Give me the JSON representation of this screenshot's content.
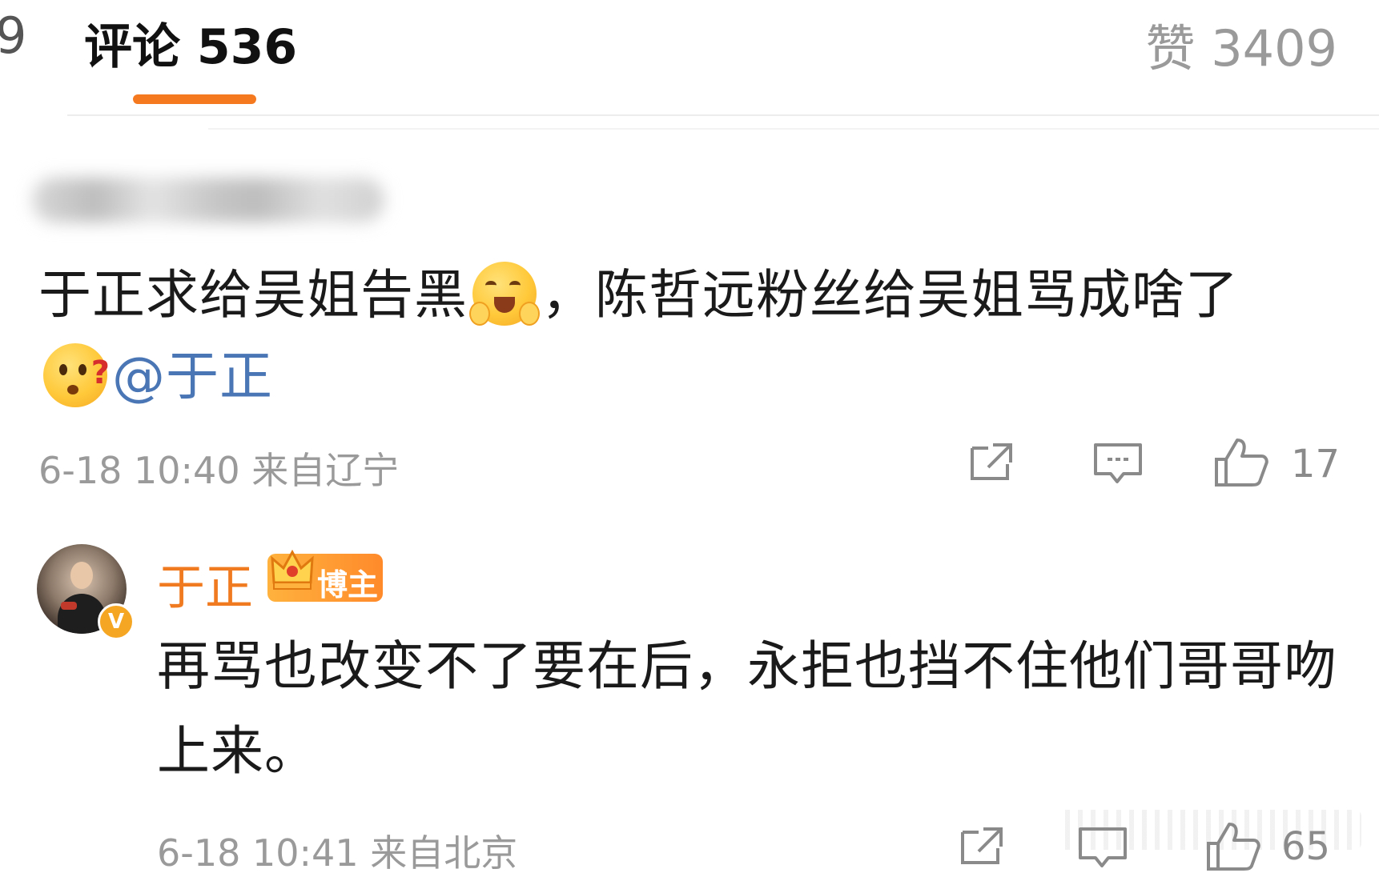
{
  "header": {
    "left_tab_fragment": "9",
    "comments_tab_label": "评论 536",
    "likes_tab_label": "赞 3409",
    "accent_color": "#f57a1f"
  },
  "comment": {
    "text_part1": "于正求给吴姐告黑",
    "emoji1": "smiling-face-with-hands-emoji",
    "text_part2": "，陈哲远粉丝给吴姐骂成啥了",
    "emoji2": "confused-question-emoji",
    "mention": "@于正",
    "timestamp": "6-18 10:40",
    "location": "来自辽宁",
    "like_count": "17"
  },
  "reply": {
    "username": "于正",
    "badge_label": "博主",
    "verify_mark": "V",
    "text": "再骂也改变不了要在后，永拒也挡不住他们哥哥吻上来。",
    "timestamp": "6-18 10:41",
    "location": "来自北京",
    "like_count": "65"
  },
  "colors": {
    "mention": "#4a76b5",
    "username": "#f07a1f",
    "meta": "#9a9a9a"
  }
}
